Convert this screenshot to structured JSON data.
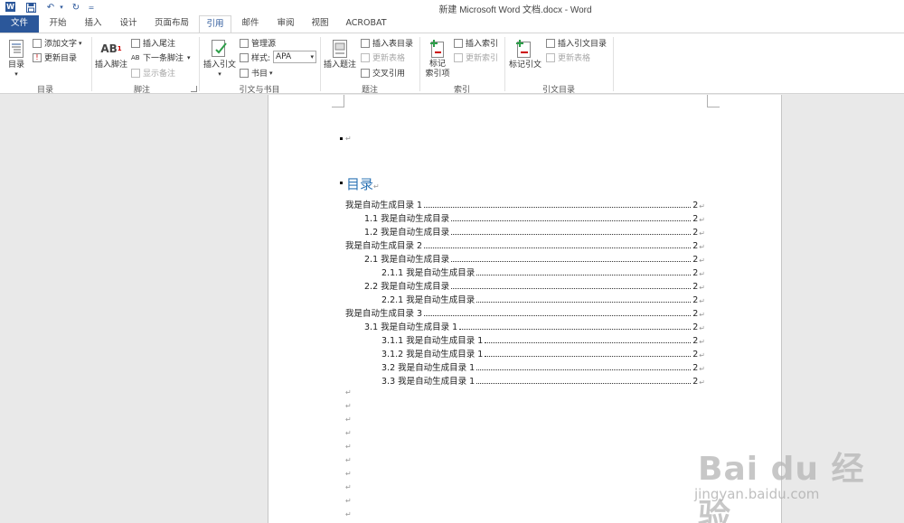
{
  "window": {
    "title": "新建 Microsoft Word 文档.docx - Word"
  },
  "quick_access": {
    "word_icon": "word-icon",
    "save_icon": "save-icon",
    "undo_icon": "undo-icon",
    "redo_icon": "redo-icon",
    "customize": "="
  },
  "tabs": [
    "文件",
    "开始",
    "插入",
    "设计",
    "页面布局",
    "引用",
    "邮件",
    "审阅",
    "视图",
    "ACROBAT"
  ],
  "active_tab": "引用",
  "ribbon": {
    "toc": {
      "big": "目录",
      "add_text": "添加文字",
      "update": "更新目录",
      "label": "目录"
    },
    "footnotes": {
      "big": "插入脚注",
      "insert_endnote": "插入尾注",
      "next_footnote": "下一条脚注",
      "show_notes": "显示备注",
      "label": "脚注"
    },
    "citations": {
      "big": "插入引文",
      "manage": "管理源",
      "style_label": "样式:",
      "style_value": "APA",
      "bibliography": "书目",
      "label": "引文与书目"
    },
    "captions": {
      "big": "插入题注",
      "insert_table_of_figures": "插入表目录",
      "update_table": "更新表格",
      "cross_reference": "交叉引用",
      "label": "题注"
    },
    "index": {
      "big_line1": "标记",
      "big_line2": "索引项",
      "insert_index": "插入索引",
      "update_index": "更新索引",
      "label": "索引"
    },
    "toa": {
      "big": "标记引文",
      "insert_toa": "插入引文目录",
      "update_table": "更新表格",
      "label": "引文目录"
    }
  },
  "document": {
    "paragraph_mark": "↵",
    "toc_heading": "目录",
    "toc": [
      {
        "text": "我是自动生成目录 1",
        "page": "2"
      },
      {
        "text": "1.1 我是自动生成目录",
        "page": "2"
      },
      {
        "text": "1.2 我是自动生成目录",
        "page": "2"
      },
      {
        "text": "我是自动生成目录 2",
        "page": "2"
      },
      {
        "text": "2.1 我是自动生成目录",
        "page": "2"
      },
      {
        "text": "2.1.1 我是自动生成目录",
        "page": "2"
      },
      {
        "text": "2.2 我是自动生成目录",
        "page": "2"
      },
      {
        "text": "2.2.1 我是自动生成目录",
        "page": "2"
      },
      {
        "text": "我是自动生成目录 3",
        "page": "2"
      },
      {
        "text": "3.1 我是自动生成目录 1",
        "page": "2"
      },
      {
        "text": "3.1.1 我是自动生成目录 1",
        "page": "2"
      },
      {
        "text": "3.1.2 我是自动生成目录 1",
        "page": "2"
      },
      {
        "text": "3.2 我是自动生成目录 1",
        "page": "2"
      },
      {
        "text": "3.3 我是自动生成目录 1",
        "page": "2"
      }
    ]
  },
  "watermark": {
    "brand": "Bai du 经验",
    "url": "jingyan.baidu.com"
  },
  "colors": {
    "accent": "#2b579a",
    "heading": "#2e74b5"
  }
}
